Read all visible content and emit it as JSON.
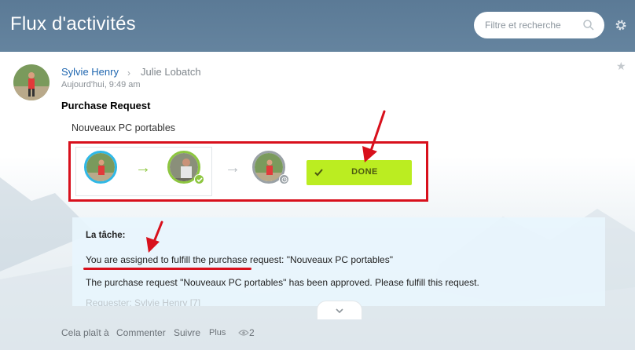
{
  "header": {
    "title": "Flux d'activités",
    "search_placeholder": "Filtre et recherche"
  },
  "post": {
    "author": "Sylvie Henry",
    "recipient": "Julie Lobatch",
    "time": "Aujourd'hui, 9:49 am",
    "title": "Purchase Request",
    "subject": "Nouveaux PC portables",
    "done_label": "DONE",
    "task": {
      "heading": "La tâche:",
      "line1": "You are assigned to fulfill the purchase request: \"Nouveaux PC portables\"",
      "line2": "The purchase request \"Nouveaux PC portables\" has been approved. Please fulfill this request.",
      "line3": "Requester: Sylvie Henry [7]"
    },
    "actions": {
      "like": "Cela plaît à",
      "comment": "Commenter",
      "follow": "Suivre",
      "more": "Plus",
      "views": "2"
    }
  },
  "icons": [
    "search-icon",
    "gear-icon",
    "star-icon",
    "chevron-right-icon",
    "arrow-right-icon",
    "check-icon",
    "clock-icon",
    "chevron-down-icon",
    "eye-icon"
  ],
  "colors": {
    "header_bg": "#5b7a96",
    "link": "#2067b0",
    "done_button": "#bbed21",
    "annotation": "#d8101c",
    "approved_ring": "#8dc63f",
    "active_ring": "#2fb8e6",
    "task_bg": "#e8f5fd"
  }
}
